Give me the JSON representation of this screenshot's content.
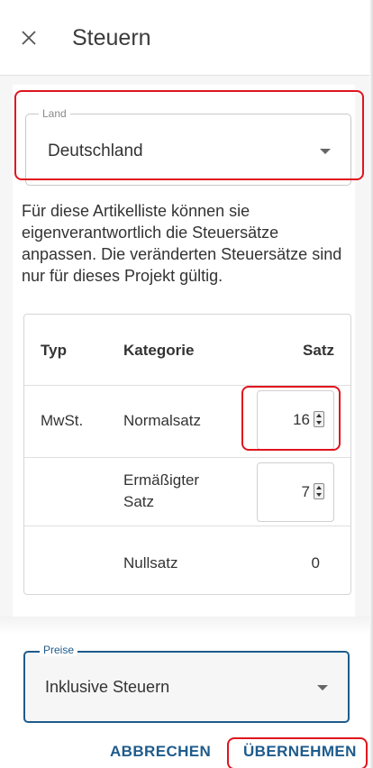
{
  "dialog": {
    "title": "Steuern",
    "close_icon": "close-icon"
  },
  "land": {
    "legend": "Land",
    "value": "Deutschland"
  },
  "info_text": "Für diese Artikelliste können sie eigenverantwortlich die Steuersätze anpassen. Die veränderten Steuersätze sind nur für dieses Projekt gültig.",
  "table": {
    "headers": {
      "typ": "Typ",
      "kategorie": "Kategorie",
      "satz": "Satz"
    },
    "rows": [
      {
        "typ": "MwSt.",
        "kategorie": "Normalsatz",
        "satz": "16"
      },
      {
        "typ": "",
        "kategorie": "Ermäßigter Satz",
        "satz": "7"
      },
      {
        "typ": "",
        "kategorie": "Nullsatz",
        "satz": "0"
      }
    ]
  },
  "preise": {
    "legend": "Preise",
    "value": "Inklusive Steuern"
  },
  "actions": {
    "cancel_label": "ABBRECHEN",
    "apply_label": "ÜBERNEHMEN"
  },
  "colors": {
    "accent": "#1e5b8c",
    "highlight": "#e0141e"
  }
}
